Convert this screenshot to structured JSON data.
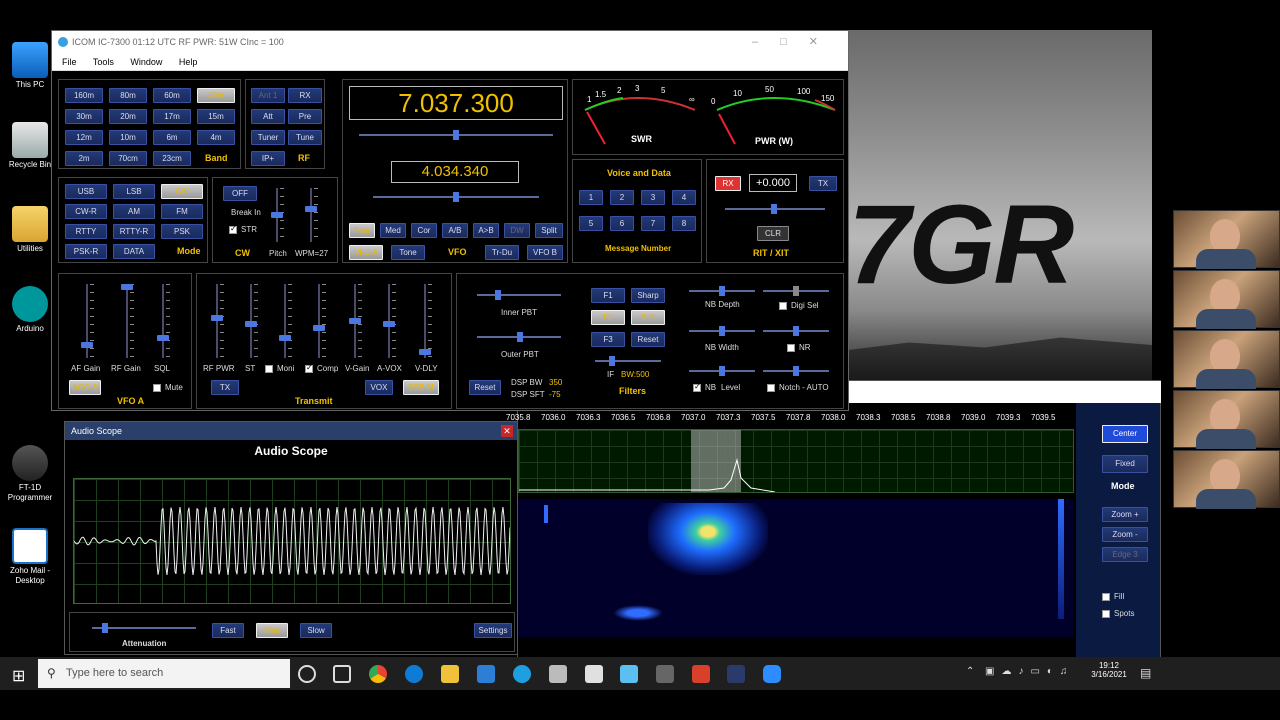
{
  "desktop": {
    "icons": [
      {
        "label": "This PC"
      },
      {
        "label": "Recycle Bin"
      },
      {
        "label": "Utilities"
      },
      {
        "label": "Arduino"
      },
      {
        "label": "FT-1D Programmer"
      },
      {
        "label": "Zoho Mail - Desktop"
      }
    ],
    "video_callsign": "7GR"
  },
  "main_window": {
    "title": "ICOM IC-7300  01:12 UTC  RF PWR: 51W  CInc = 100",
    "menu": [
      "File",
      "Tools",
      "Window",
      "Help"
    ],
    "band": {
      "buttons": [
        "160m",
        "80m",
        "60m",
        "40m",
        "30m",
        "20m",
        "17m",
        "15m",
        "12m",
        "10m",
        "6m",
        "4m",
        "2m",
        "70cm",
        "23cm"
      ],
      "selected": "40m",
      "label": "Band"
    },
    "rf": {
      "buttons": [
        "Ant 1",
        "RX",
        "Att",
        "Pre",
        "Tuner",
        "Tune",
        "IP+"
      ],
      "label": "RF"
    },
    "vfo": {
      "freq_a": "7.037.300",
      "freq_b": "4.034.340",
      "buttons": [
        "Fine",
        "Med",
        "Cor",
        "A/B",
        "A>B",
        "DW",
        "Split",
        "VFO A",
        "Tone",
        "Tr-Du",
        "VFO B"
      ],
      "label": "VFO"
    },
    "meters": {
      "swr_label": "SWR",
      "swr_scale": [
        "1",
        "1.5",
        "2",
        "3",
        "5",
        "∞"
      ],
      "pwr_label": "PWR (W)",
      "pwr_scale": [
        "0",
        "10",
        "50",
        "100",
        "150"
      ]
    },
    "voice": {
      "title": "Voice and Data",
      "buttons": [
        "1",
        "2",
        "3",
        "4",
        "5",
        "6",
        "7",
        "8"
      ],
      "label": "Message Number"
    },
    "rit": {
      "rx": "RX",
      "value": "+0.000",
      "tx": "TX",
      "clr": "CLR",
      "label": "RIT / XIT"
    },
    "mode": {
      "buttons": [
        "USB",
        "LSB",
        "CW",
        "CW-R",
        "AM",
        "FM",
        "RTTY",
        "RTTY-R",
        "PSK",
        "PSK-R",
        "DATA"
      ],
      "selected": "CW",
      "label": "Mode"
    },
    "cw": {
      "off": "OFF",
      "break_in": "Break In",
      "str": "STR",
      "label": "CW",
      "pitch": "Pitch",
      "wpm": "WPM=27"
    },
    "vfoa": {
      "labels": [
        "AF Gain",
        "RF Gain",
        "SQL"
      ],
      "agc": "AGC-S",
      "mute": "Mute",
      "title": "VFO A",
      "af_level": 0.15,
      "rf_level": 1.0,
      "sql_level": 0.25
    },
    "transmit": {
      "labels": [
        "RF PWR",
        "ST",
        "Moni",
        "Comp",
        "V-Gain",
        "A-VOX",
        "V-DLY"
      ],
      "tx": "TX",
      "vox": "VOX",
      "ssbm": "SSB-M",
      "title": "Transmit",
      "levels": [
        0.55,
        0.45,
        0.25,
        0.4,
        0.5,
        0.45,
        0.05
      ]
    },
    "filters": {
      "inner_pbt": "Inner PBT",
      "outer_pbt": "Outer PBT",
      "reset": "Reset",
      "dsp_bw_label": "DSP BW",
      "dsp_bw": "350",
      "dsp_sft_label": "DSP SFT",
      "dsp_sft": "-75",
      "buttons": [
        "F1",
        "Sharp",
        "F2",
        "Soft",
        "F3",
        "Reset"
      ],
      "if_label": "IF",
      "if_bw": "BW:500",
      "title": "Filters",
      "nb_depth": "NB Depth",
      "digi_sel": "Digi Sel",
      "nb_width": "NB Width",
      "nr": "NR",
      "nb": "NB",
      "level": "Level",
      "notch": "Notch - AUTO"
    }
  },
  "audio_scope": {
    "window_title": "Audio Scope",
    "title": "Audio Scope",
    "buttons": [
      "Fast",
      "Med",
      "Slow"
    ],
    "selected": "Med",
    "attenuation": "Attenuation",
    "settings": "Settings"
  },
  "spectrum": {
    "freq_ticks": [
      "7035.8",
      "7036.0",
      "7036.3",
      "7036.5",
      "7036.8",
      "7037.0",
      "7037.3",
      "7037.5",
      "7037.8",
      "7038.0",
      "7038.3",
      "7038.5",
      "7038.8",
      "7039.0",
      "7039.3",
      "7039.5"
    ],
    "buttons": [
      "Center",
      "Fixed"
    ],
    "mode_label": "Mode",
    "zoom": [
      "Zoom +",
      "Zoom -",
      "Edge 3"
    ],
    "fill": "Fill",
    "spots": "Spots"
  },
  "taskbar": {
    "search_placeholder": "Type here to search",
    "time": "19:12",
    "date": "3/16/2021"
  }
}
